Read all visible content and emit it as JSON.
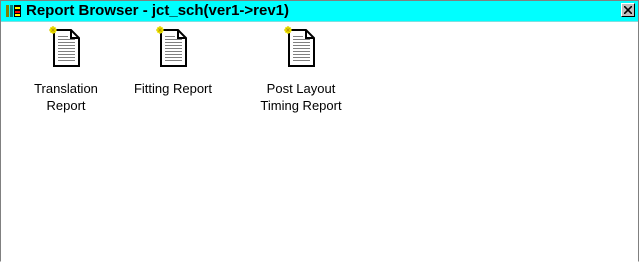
{
  "window": {
    "title": "Report Browser - jct_sch(ver1->rev1)",
    "titlebar_color": "#00ffff",
    "icon": "report-browser-icon",
    "close_icon": "close-icon"
  },
  "reports": [
    {
      "label": "Translation\nReport",
      "icon": "document-icon"
    },
    {
      "label": "Fitting Report",
      "icon": "document-icon"
    },
    {
      "label": "Post Layout\nTiming Report",
      "icon": "document-icon"
    }
  ]
}
